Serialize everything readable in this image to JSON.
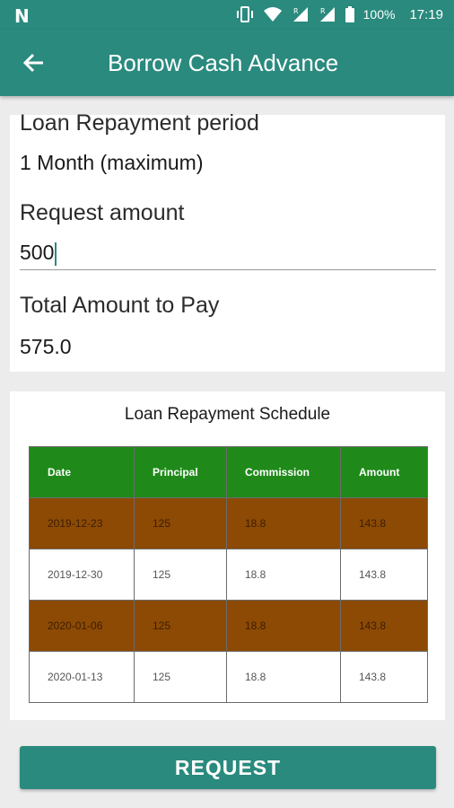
{
  "status_bar": {
    "battery_percent": "100%",
    "time": "17:19"
  },
  "app_bar": {
    "title": "Borrow Cash Advance"
  },
  "form": {
    "period_label": "Loan Repayment period",
    "period_value": "1 Month (maximum)",
    "request_label": "Request amount",
    "request_value": "500",
    "total_label": "Total Amount to Pay",
    "total_value": "575.0"
  },
  "schedule": {
    "title": "Loan Repayment Schedule",
    "columns": [
      "Date",
      "Principal",
      "Commission",
      "Amount"
    ],
    "rows": [
      [
        "2019-12-23",
        "125",
        "18.8",
        "143.8"
      ],
      [
        "2019-12-30",
        "125",
        "18.8",
        "143.8"
      ],
      [
        "2020-01-06",
        "125",
        "18.8",
        "143.8"
      ],
      [
        "2020-01-13",
        "125",
        "18.8",
        "143.8"
      ]
    ],
    "header_color": "#1f8a1a",
    "alt_row_color": "#8c4a05"
  },
  "action": {
    "request_label": "REQUEST"
  },
  "colors": {
    "primary": "#2a8a7e"
  }
}
